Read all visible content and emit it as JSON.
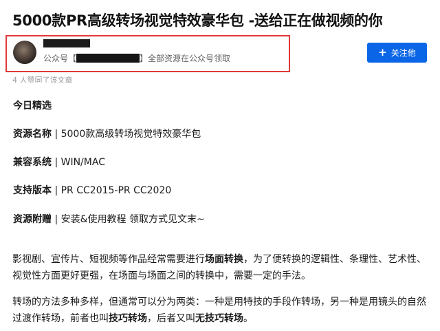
{
  "article": {
    "title": "5000款PR高级转场视觉特效豪华包 -送给正在做视频的你"
  },
  "author": {
    "name": "",
    "desc_prefix": "公众号【",
    "desc_suffix": "】全部资源在公众号领取",
    "follow_label": "关注他",
    "follow_color": "#0a66e6",
    "highlight_color": "#e0393b"
  },
  "likes": "4 人赞同了该文章",
  "sections": {
    "today": "今日精选",
    "name_label": "资源名称",
    "name_value": " | 5000款高级转场视觉特效豪华包",
    "compat_label": "兼容系统",
    "compat_value": " | WIN/MAC",
    "version_label": "支持版本",
    "version_value": " | PR CC2015-PR CC2020",
    "extra_label": "资源附赠",
    "extra_value": " | 安装&使用教程 领取方式见文末~"
  },
  "para1": {
    "line1_a": "影视剧、宣传片、短视频等作品经常需要进行",
    "line1_bold": "场面转换",
    "line1_b": "，为了便转换的逻辑性、条理性、艺术性、",
    "line2": "视觉性方面更好更强，在场面与场面之间的转换中，需要一定的手法。"
  },
  "para2": {
    "line1": "转场的方法多种多样，但通常可以分为两类：一种是用特技的手段作转场，另一种是用镜头的自然",
    "line2_a": "过渡作转场，前者也叫",
    "line2_bold1": "技巧转场",
    "line2_b": "，后者又叫",
    "line2_bold2": "无技巧转场",
    "line2_c": "。"
  }
}
